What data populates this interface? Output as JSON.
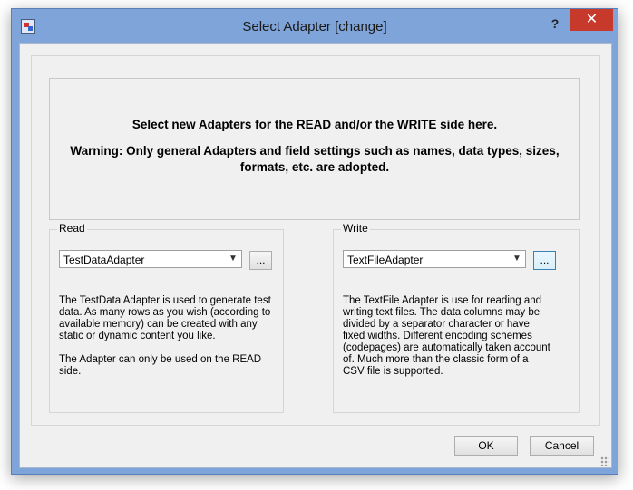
{
  "window": {
    "title": "Select Adapter [change]",
    "help_label": "?",
    "close_label": "✕"
  },
  "header": {
    "heading": "Select new Adapters for the READ and/or the WRITE side here.",
    "warning": "Warning: Only general Adapters and field settings such as names, data types, sizes, formats, etc. are adopted."
  },
  "read": {
    "label": "Read",
    "adapter": "TestDataAdapter",
    "dots_label": "...",
    "description": "The TestData Adapter is used to generate test data. As many rows as you wish (according to available memory) can be created with any static or dynamic content you like.\n\nThe Adapter can only be used on the READ side."
  },
  "write": {
    "label": "Write",
    "adapter": "TextFileAdapter",
    "dots_label": "...",
    "description": "The TextFile Adapter is use for reading and writing text files. The data columns may be divided by a separator character or have fixed widths. Different encoding schemes (codepages) are automatically taken account of. Much more than the classic form of a CSV file is supported."
  },
  "footer": {
    "ok_label": "OK",
    "cancel_label": "Cancel"
  },
  "colors": {
    "frame": "#7fa4d9",
    "close": "#c7392b",
    "client": "#f0f0f0"
  }
}
